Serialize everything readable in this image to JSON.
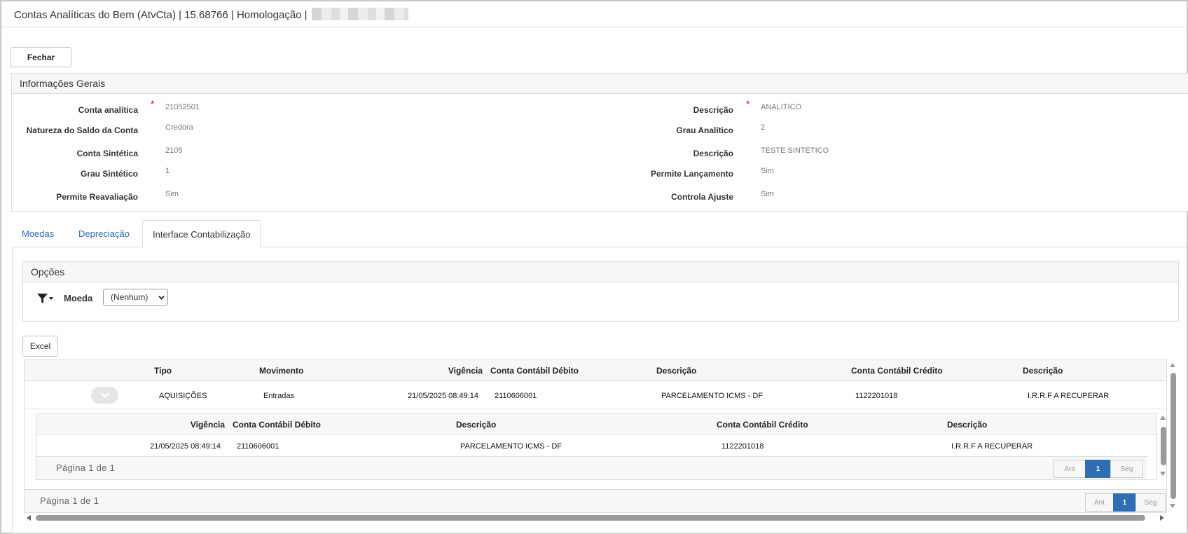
{
  "window": {
    "title": "Contas Analíticas do Bem (AtvCta) | 15.68766 | Homologação |"
  },
  "toolbar": {
    "close_label": "Fechar"
  },
  "general_info": {
    "title": "Informações Gerais",
    "left": [
      {
        "label": "Conta analítica",
        "value": "21052501",
        "required": true
      },
      {
        "label": "Natureza do Saldo da Conta",
        "value": "Credora"
      },
      {
        "label": "Conta Sintética",
        "value": "2105"
      },
      {
        "label": "Grau Sintético",
        "value": "1"
      },
      {
        "label": "Permite Reavaliação",
        "value": "Sim"
      }
    ],
    "right": [
      {
        "label": "Descrição",
        "value": "ANALITICO",
        "required": true
      },
      {
        "label": "Grau Analítico",
        "value": "2"
      },
      {
        "label": "Descrição",
        "value": "TESTE SINTETICO"
      },
      {
        "label": "Permite Lançamento",
        "value": "Sim"
      },
      {
        "label": "Controla Ajuste",
        "value": "Sim"
      }
    ]
  },
  "tabs": [
    {
      "label": "Moedas"
    },
    {
      "label": "Depreciação"
    },
    {
      "label": "Interface Contabilização",
      "active": true
    }
  ],
  "options": {
    "title": "Opções",
    "filter_icon": "filter-icon",
    "currency_label": "Moeda",
    "currency_selected": "(Nenhum)"
  },
  "excel_label": "Excel",
  "main_grid": {
    "headers": [
      "Tipo",
      "Movimento",
      "Vigência",
      "Conta Contábil Débito",
      "Descrição",
      "Conta Contábil Crédito",
      "Descrição"
    ],
    "rows": [
      [
        "AQUISIÇÕES",
        "Entradas",
        "21/05/2025 08:49:14",
        "2110606001",
        "PARCELAMENTO ICMS - DF",
        "1122201018",
        "I.R.R.F A RECUPERAR"
      ]
    ],
    "pager": {
      "text": "Página 1 de 1",
      "prev": "Ant",
      "page": "1",
      "next": "Seg"
    }
  },
  "detail_grid": {
    "headers": [
      "Vigência",
      "Conta Contábil Débito",
      "Descrição",
      "Conta Contábil Crédito",
      "Descrição"
    ],
    "rows": [
      [
        "21/05/2025 08:49:14",
        "2110606001",
        "PARCELAMENTO ICMS - DF",
        "1122201018",
        "I.R.R.F A RECUPERAR"
      ]
    ],
    "pager": {
      "text": "Página 1 de 1",
      "prev": "Ant",
      "page": "1",
      "next": "Seg"
    }
  },
  "colors": {
    "link": "#2a6ebb",
    "accent": "#2f6db5",
    "required": "#dd0000"
  }
}
